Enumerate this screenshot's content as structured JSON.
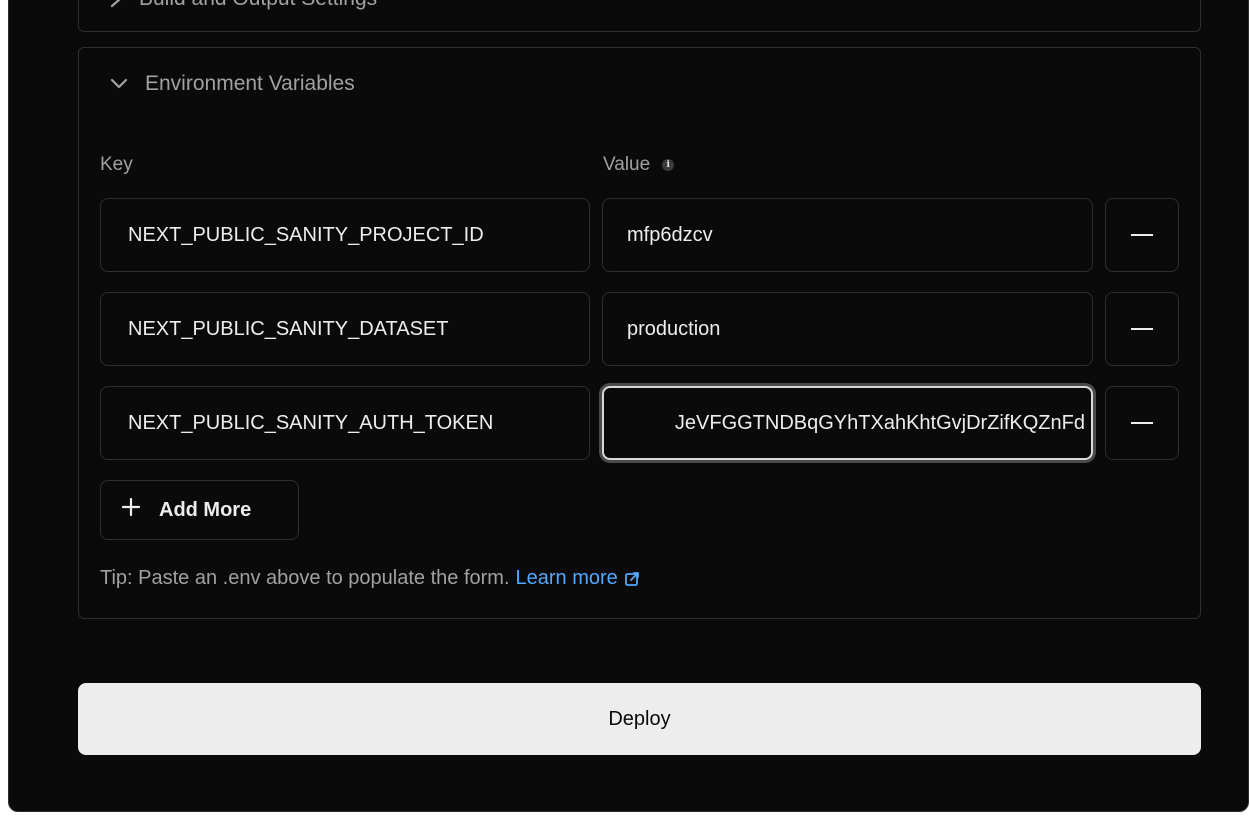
{
  "sections": {
    "build": {
      "title": "Build and Output Settings",
      "icon": "chevron-right-icon"
    },
    "env": {
      "title": "Environment Variables",
      "icon": "chevron-down-icon"
    }
  },
  "env_vars": {
    "key_label": "Key",
    "value_label": "Value",
    "rows": [
      {
        "key": "NEXT_PUBLIC_SANITY_PROJECT_ID",
        "value": "mfp6dzcv"
      },
      {
        "key": "NEXT_PUBLIC_SANITY_DATASET",
        "value": "production"
      },
      {
        "key": "NEXT_PUBLIC_SANITY_AUTH_TOKEN",
        "value": "JeVFGGTNDBqGYhTXahKhtGvjDrZifKQZnFd"
      }
    ],
    "add_more_label": "Add More",
    "tip_text": "Tip: Paste an .env above to populate the form.",
    "learn_more_label": "Learn more"
  },
  "deploy_label": "Deploy",
  "colors": {
    "background": "#0a0a0a",
    "border": "#2e2e2e",
    "text": "#ededed",
    "muted": "#a1a1a1",
    "link": "#52a8ff"
  }
}
